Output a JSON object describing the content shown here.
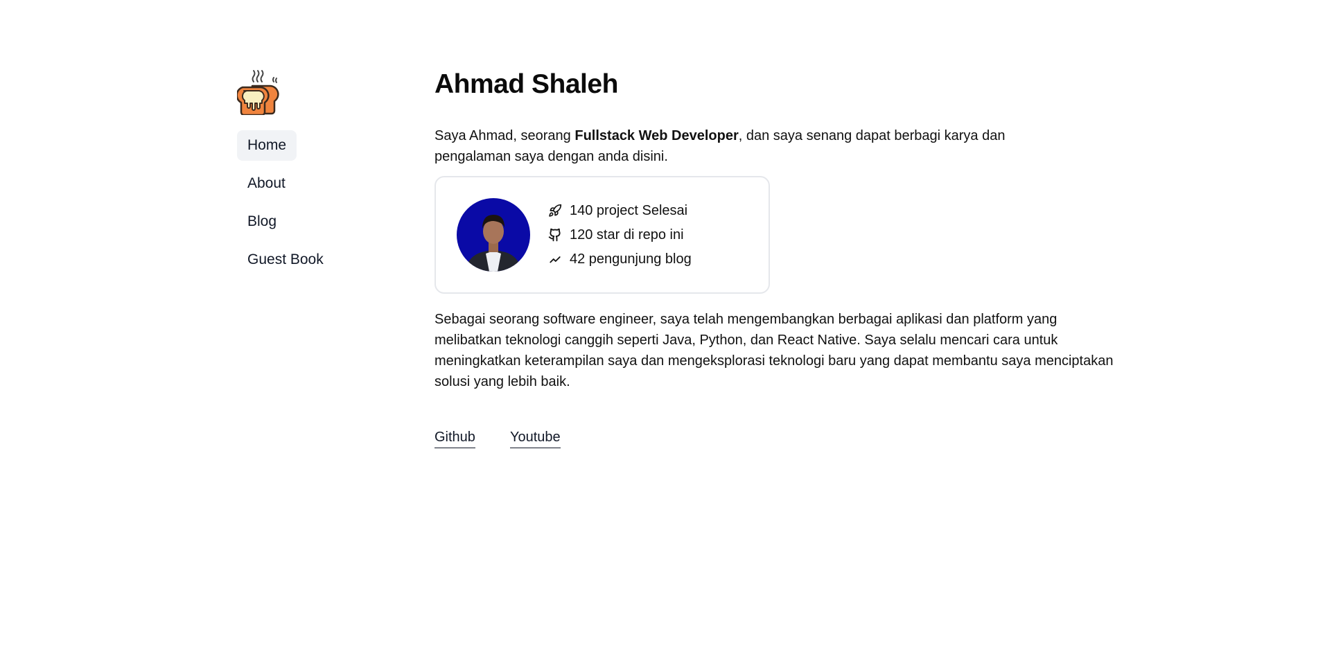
{
  "colors": {
    "nav_active_bg": "#f1f3f6",
    "card_border": "#e5e7eb",
    "avatar_bg": "#0a0aa6",
    "logo_bread": "#f0843e",
    "logo_cream": "#f9efc0"
  },
  "logo": {
    "icon": "toast-bread-icon"
  },
  "nav": {
    "items": [
      {
        "label": "Home",
        "active": true
      },
      {
        "label": "About",
        "active": false
      },
      {
        "label": "Blog",
        "active": false
      },
      {
        "label": "Guest Book",
        "active": false
      }
    ]
  },
  "main": {
    "title": "Ahmad Shaleh",
    "intro": {
      "before": "Saya Ahmad, seorang ",
      "bold": "Fullstack Web Developer",
      "after": ", dan saya senang dapat berbagi karya dan pengalaman saya dengan anda disini."
    },
    "stats": [
      {
        "icon": "rocket-icon",
        "text": "140 project Selesai"
      },
      {
        "icon": "github-icon",
        "text": "120 star di repo ini"
      },
      {
        "icon": "trending-up-icon",
        "text": "42 pengunjung blog"
      }
    ],
    "bio": "Sebagai seorang software engineer, saya telah mengembangkan berbagai aplikasi dan platform yang melibatkan teknologi canggih seperti Java, Python, dan React Native. Saya selalu mencari cara untuk meningkatkan keterampilan saya dan mengeksplorasi teknologi baru yang dapat membantu saya menciptakan solusi yang lebih baik.",
    "links": [
      {
        "label": "Github"
      },
      {
        "label": "Youtube"
      }
    ]
  }
}
